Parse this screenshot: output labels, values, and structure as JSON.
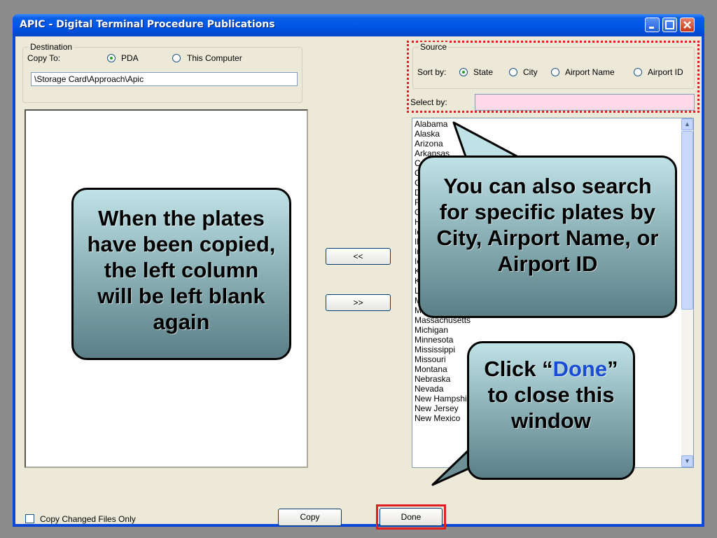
{
  "window": {
    "title": "APIC - Digital Terminal Procedure Publications"
  },
  "destination": {
    "group_label": "Destination",
    "copy_to_label": "Copy To:",
    "options": [
      "PDA",
      "This Computer"
    ],
    "selected": "PDA",
    "path_value": "\\Storage Card\\Approach\\Apic"
  },
  "source": {
    "group_label": "Source",
    "sort_by_label": "Sort by:",
    "sort_options": [
      "State",
      "City",
      "Airport Name",
      "Airport ID"
    ],
    "selected": "State",
    "select_by_label": "Select by:",
    "select_by_value": ""
  },
  "states": [
    "Alabama",
    "Alaska",
    "Arizona",
    "Arkansas",
    "California",
    "Colorado",
    "Connecticut",
    "Delaware",
    "Florida",
    "Georgia",
    "Hawaii",
    "Idaho",
    "Illinois",
    "Indiana",
    "Iowa",
    "Kansas",
    "Kentucky",
    "Louisiana",
    "Maine",
    "Maryland",
    "Massachusetts",
    "Michigan",
    "Minnesota",
    "Mississippi",
    "Missouri",
    "Montana",
    "Nebraska",
    "Nevada",
    "New Hampshire",
    "New Jersey",
    "New Mexico"
  ],
  "buttons": {
    "remove": "<<",
    "add": ">>",
    "copy": "Copy",
    "done": "Done"
  },
  "copy_changed_label": "Copy Changed Files Only",
  "callouts": {
    "left": "When the plates have been copied, the left column will be left blank again",
    "right": "You can also search for specific plates by City, Airport Name, or Airport ID",
    "bottom_pre": "Click “",
    "bottom_highlight": "Done",
    "bottom_post": "” to close this window"
  },
  "colors": {
    "highlight_box": "#e02020",
    "callout_text_highlight": "#1a4cd6"
  }
}
